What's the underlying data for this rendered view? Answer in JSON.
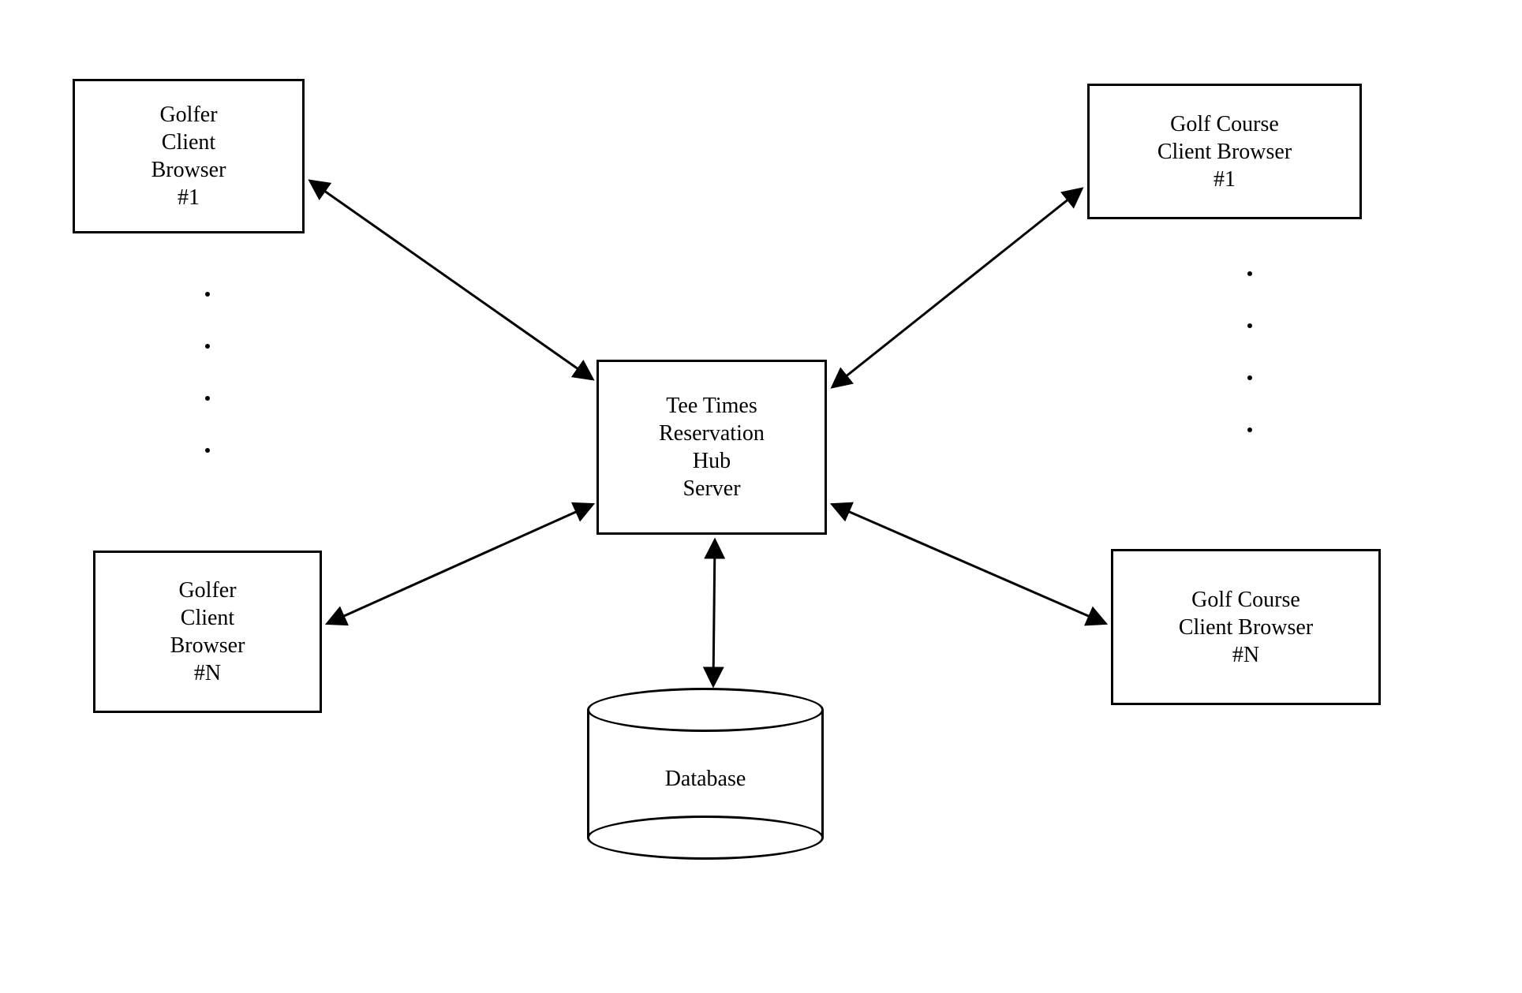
{
  "nodes": {
    "golfer_client_1": "Golfer\nClient\nBrowser\n#1",
    "golfer_client_n": "Golfer\nClient\nBrowser\n#N",
    "golf_course_client_1": "Golf Course\nClient Browser\n#1",
    "golf_course_client_n": "Golf Course\nClient Browser\n#N",
    "hub_server": "Tee Times\nReservation\nHub\nServer",
    "database": "Database"
  },
  "ellipses": {
    "left": [
      "·",
      "·",
      "·",
      "·"
    ],
    "right": [
      "·",
      "·",
      "·",
      "·"
    ]
  },
  "connections": [
    {
      "from": "golfer_client_1",
      "to": "hub_server",
      "bidirectional": true
    },
    {
      "from": "golfer_client_n",
      "to": "hub_server",
      "bidirectional": true
    },
    {
      "from": "golf_course_client_1",
      "to": "hub_server",
      "bidirectional": true
    },
    {
      "from": "golf_course_client_n",
      "to": "hub_server",
      "bidirectional": true
    },
    {
      "from": "hub_server",
      "to": "database",
      "bidirectional": true
    }
  ]
}
